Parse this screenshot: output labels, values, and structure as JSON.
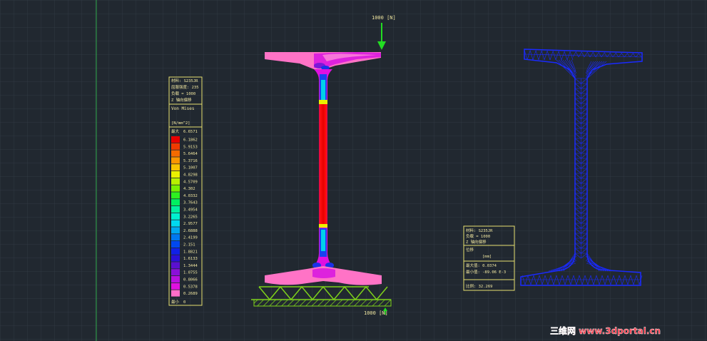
{
  "colors": {
    "background": "#212830",
    "grid": "#2f3842",
    "legend_border": "#e8e070",
    "legend_text": "#f0e6a0",
    "mesh": "#1a2aff",
    "force_arrow": "#22dd22",
    "support": "#7fd31a",
    "watermark": "#ff3344"
  },
  "load": {
    "top_label": "1000 [N]",
    "bottom_label": "1000 [N]"
  },
  "stress_legend": {
    "material_line": "材料: S235JR",
    "yield_line": "屈服强度: 235",
    "load_line": "负载 = 1000",
    "axis_line": "Z 轴向偏移",
    "result_title": "Von Mises",
    "unit": "[N/mm^2]",
    "max_label": "最大",
    "max_value": "6.6571",
    "min_label": "最小",
    "min_value": "0",
    "scale": [
      {
        "color": "#e80000",
        "value": "6.1862"
      },
      {
        "color": "#f03a00",
        "value": "5.9153"
      },
      {
        "color": "#f56a00",
        "value": "5.6464"
      },
      {
        "color": "#fa9600",
        "value": "5.3716"
      },
      {
        "color": "#f8c400",
        "value": "5.1007"
      },
      {
        "color": "#eaf000",
        "value": "4.8298"
      },
      {
        "color": "#b8f000",
        "value": "4.5709"
      },
      {
        "color": "#78f000",
        "value": "4.302"
      },
      {
        "color": "#2ef020",
        "value": "4.0332"
      },
      {
        "color": "#00f060",
        "value": "3.7643"
      },
      {
        "color": "#00f0a0",
        "value": "3.4954"
      },
      {
        "color": "#00f0d0",
        "value": "3.2265"
      },
      {
        "color": "#00d8f0",
        "value": "2.9577"
      },
      {
        "color": "#00a8f0",
        "value": "2.6888"
      },
      {
        "color": "#0078f0",
        "value": "2.4199"
      },
      {
        "color": "#0048f0",
        "value": "2.151"
      },
      {
        "color": "#1020e8",
        "value": "1.8821"
      },
      {
        "color": "#2a10d8",
        "value": "1.6133"
      },
      {
        "color": "#5a10d0",
        "value": "1.3444"
      },
      {
        "color": "#8a10d8",
        "value": "1.0755"
      },
      {
        "color": "#b810e0",
        "value": "0.8066"
      },
      {
        "color": "#e010e0",
        "value": "0.5378"
      },
      {
        "color": "#ff6ec8",
        "value": "0.2689"
      }
    ]
  },
  "displacement_legend": {
    "material_line": "材料: S235JR",
    "load_line": "负载 = 1000",
    "axis_line": "Z 轴向偏移",
    "result_title": "位移",
    "unit": "[mm]",
    "max_line": "最大值: 0.0374",
    "min_line": "最小值: -89.06 E-3",
    "factor_line": "比例: 32.269"
  },
  "watermark": "三维网 www.3dportal.cn"
}
